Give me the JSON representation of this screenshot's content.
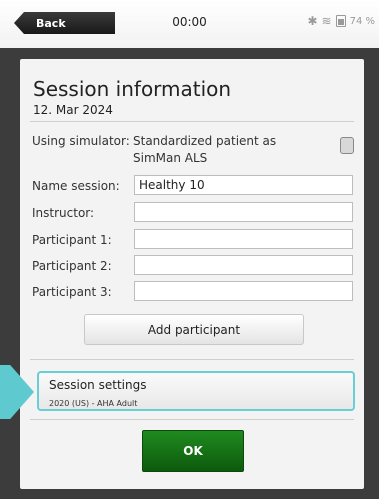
{
  "topbar": {
    "back_label": "Back",
    "time": "00:00",
    "battery": "74 %"
  },
  "dialog": {
    "title": "Session information",
    "date": "12. Mar 2024",
    "simulator_label": "Using simulator:",
    "simulator_value": "Standardized patient as SimMan ALS",
    "simulator_checked": false,
    "fields": [
      {
        "label": "Name session:",
        "value": "Healthy 10"
      },
      {
        "label": "Instructor:",
        "value": ""
      },
      {
        "label": "Participant 1:",
        "value": ""
      },
      {
        "label": "Participant 2:",
        "value": ""
      },
      {
        "label": "Participant 3:",
        "value": ""
      }
    ],
    "add_participant_label": "Add participant",
    "settings_title": "Session settings",
    "settings_subtitle": "2020 (US) - AHA Adult",
    "ok_label": "OK"
  },
  "icons": [
    "bluetooth-icon",
    "wifi-icon",
    "battery-icon",
    "back-arrow-icon",
    "pointer-arrow-icon"
  ],
  "colors": {
    "highlight": "#69cfd5",
    "ok_green": "#1a7a1a"
  }
}
